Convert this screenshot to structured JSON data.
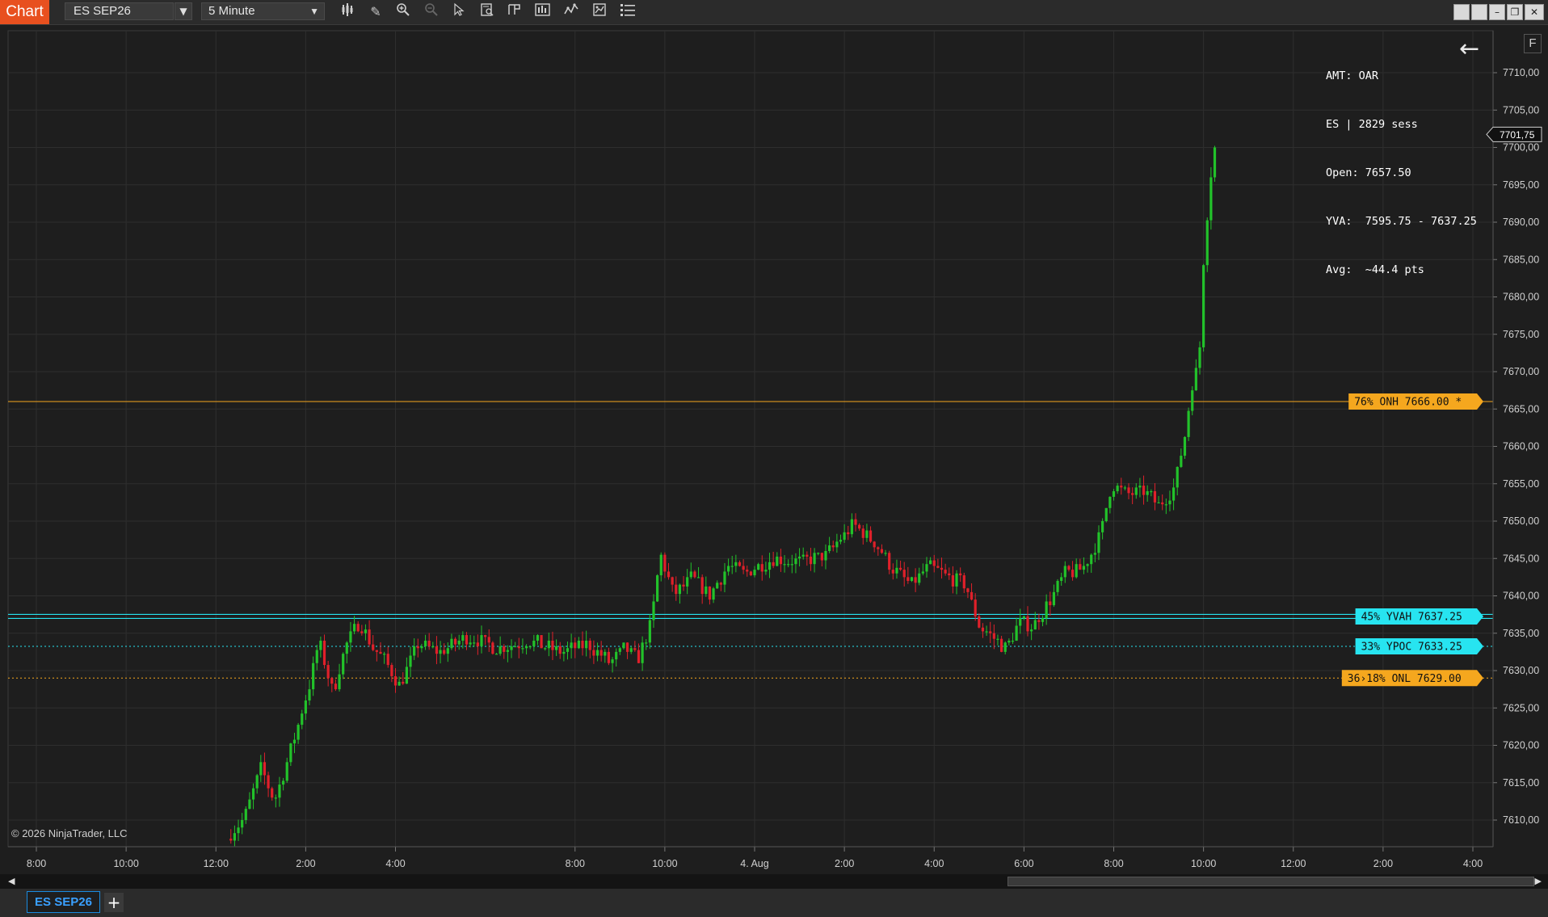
{
  "window": {
    "app_tab": "Chart",
    "instrument": "ES SEP26",
    "period": "5 Minute",
    "window_buttons": [
      "restore-down",
      "minimize",
      "maximize",
      "close"
    ]
  },
  "toolbar": {
    "icons": [
      "bar-style-icon",
      "draw-pencil-icon",
      "zoom-in-icon",
      "zoom-out-icon",
      "pointer-icon",
      "data-box-icon",
      "templates-icon",
      "chart-trader-icon",
      "indicators-icon",
      "strategies-icon",
      "properties-icon"
    ]
  },
  "info_panel": {
    "lines": [
      "AMT: OAR",
      "ES | 2829 sess",
      "Open: 7657.50",
      "YVA:  7595.75 - 7637.25",
      "Avg:  ~44.4 pts"
    ]
  },
  "f_button": "F",
  "copyright": "© 2026 NinjaTrader, LLC",
  "bottom_tabs": {
    "active": "ES SEP26",
    "add": "+"
  },
  "colors": {
    "up": "#22c22a",
    "down": "#e0202a",
    "orange": "#f5a71e",
    "cyan": "#27e4f0",
    "grid": "#2e2e2e",
    "background": "#1e1e1e"
  },
  "chart_data": {
    "type": "candlestick",
    "instrument": "ES SEP26",
    "period": "5 Minute",
    "ylim": [
      7606.0,
      7715.0
    ],
    "y_ticks": [
      7610,
      7615,
      7620,
      7625,
      7630,
      7635,
      7640,
      7645,
      7650,
      7655,
      7660,
      7665,
      7670,
      7675,
      7680,
      7685,
      7690,
      7695,
      7700,
      7705,
      7710
    ],
    "y_tick_labels": [
      "7610,00",
      "7615,00",
      "7620,00",
      "7625,00",
      "7630,00",
      "7635,00",
      "7640,00",
      "7645,00",
      "7650,00",
      "7655,00",
      "7660,00",
      "7665,00",
      "7670,00",
      "7675,00",
      "7680,00",
      "7685,00",
      "7690,00",
      "7695,00",
      "7700,00",
      "7705,00",
      "7710,00"
    ],
    "x_ticks": [
      {
        "label": "8:00",
        "t": -16
      },
      {
        "label": "10:00",
        "t": -14
      },
      {
        "label": "12:00",
        "t": -12
      },
      {
        "label": "2:00",
        "t": -10
      },
      {
        "label": "4:00",
        "t": -8
      },
      {
        "label": "8:00",
        "t": -4
      },
      {
        "label": "10:00",
        "t": -2
      },
      {
        "label": "4. Aug",
        "t": 0
      },
      {
        "label": "2:00",
        "t": 2
      },
      {
        "label": "4:00",
        "t": 4
      },
      {
        "label": "6:00",
        "t": 6
      },
      {
        "label": "8:00",
        "t": 8
      },
      {
        "label": "10:00",
        "t": 10
      },
      {
        "label": "12:00",
        "t": 12
      },
      {
        "label": "2:00",
        "t": 14
      },
      {
        "label": "4:00",
        "t": 16
      }
    ],
    "x_unit": "hours relative to 4. Aug 00:00",
    "last_price": 7701.75,
    "last_price_label": "7701,75",
    "levels": [
      {
        "label": "76% ONH 7666.00 *",
        "price": 7666.0,
        "color": "orange",
        "style": "solid"
      },
      {
        "label": "45% YVAH 7637.25",
        "price": 7637.25,
        "color": "cyan",
        "style": "double"
      },
      {
        "label": "33% YPOC 7633.25",
        "price": 7633.25,
        "color": "cyan",
        "style": "dotted"
      },
      {
        "label": "36›18% ONL 7629.00",
        "price": 7629.0,
        "color": "orange",
        "style": "dotted"
      }
    ],
    "path_anchors": [
      {
        "t": -11.75,
        "p": 7607.5
      },
      {
        "t": -11.35,
        "p": 7610.5
      },
      {
        "t": -11.0,
        "p": 7617.0
      },
      {
        "t": -10.7,
        "p": 7612.5
      },
      {
        "t": -10.3,
        "p": 7620.0
      },
      {
        "t": -9.9,
        "p": 7628.5
      },
      {
        "t": -9.7,
        "p": 7634.0
      },
      {
        "t": -9.4,
        "p": 7627.0
      },
      {
        "t": -9.1,
        "p": 7633.5
      },
      {
        "t": -8.8,
        "p": 7636.5
      },
      {
        "t": -8.5,
        "p": 7633.0
      },
      {
        "t": -8.2,
        "p": 7631.0
      },
      {
        "t": -7.9,
        "p": 7628.0
      },
      {
        "t": -7.5,
        "p": 7633.5
      },
      {
        "t": -7.0,
        "p": 7632.5
      },
      {
        "t": -6.4,
        "p": 7634.5
      },
      {
        "t": -5.7,
        "p": 7633.0
      },
      {
        "t": -5.0,
        "p": 7634.0
      },
      {
        "t": -4.3,
        "p": 7632.5
      },
      {
        "t": -3.7,
        "p": 7633.5
      },
      {
        "t": -3.2,
        "p": 7631.0
      },
      {
        "t": -2.9,
        "p": 7633.0
      },
      {
        "t": -2.6,
        "p": 7631.5
      },
      {
        "t": -2.3,
        "p": 7636.5
      },
      {
        "t": -2.1,
        "p": 7645.5
      },
      {
        "t": -1.8,
        "p": 7640.0
      },
      {
        "t": -1.4,
        "p": 7642.5
      },
      {
        "t": -1.0,
        "p": 7640.0
      },
      {
        "t": -0.6,
        "p": 7644.0
      },
      {
        "t": -0.2,
        "p": 7643.0
      },
      {
        "t": 0.4,
        "p": 7645.0
      },
      {
        "t": 1.0,
        "p": 7644.5
      },
      {
        "t": 1.6,
        "p": 7645.5
      },
      {
        "t": 2.2,
        "p": 7649.5
      },
      {
        "t": 2.7,
        "p": 7647.0
      },
      {
        "t": 3.1,
        "p": 7643.5
      },
      {
        "t": 3.5,
        "p": 7641.5
      },
      {
        "t": 3.9,
        "p": 7644.0
      },
      {
        "t": 4.3,
        "p": 7642.5
      },
      {
        "t": 4.7,
        "p": 7641.5
      },
      {
        "t": 5.0,
        "p": 7636.0
      },
      {
        "t": 5.3,
        "p": 7634.5
      },
      {
        "t": 5.6,
        "p": 7633.0
      },
      {
        "t": 5.9,
        "p": 7636.5
      },
      {
        "t": 6.2,
        "p": 7636.0
      },
      {
        "t": 6.6,
        "p": 7639.5
      },
      {
        "t": 6.9,
        "p": 7643.0
      },
      {
        "t": 7.3,
        "p": 7643.5
      },
      {
        "t": 7.7,
        "p": 7648.0
      },
      {
        "t": 7.95,
        "p": 7655.0
      },
      {
        "t": 8.3,
        "p": 7653.5
      },
      {
        "t": 8.7,
        "p": 7654.0
      },
      {
        "t": 9.0,
        "p": 7652.0
      },
      {
        "t": 9.35,
        "p": 7654.5
      },
      {
        "t": 9.6,
        "p": 7662.0
      },
      {
        "t": 9.75,
        "p": 7668.5
      },
      {
        "t": 9.9,
        "p": 7671.0
      },
      {
        "t": 10.0,
        "p": 7685.0
      },
      {
        "t": 10.15,
        "p": 7696.0
      },
      {
        "t": 10.3,
        "p": 7701.75
      }
    ]
  }
}
